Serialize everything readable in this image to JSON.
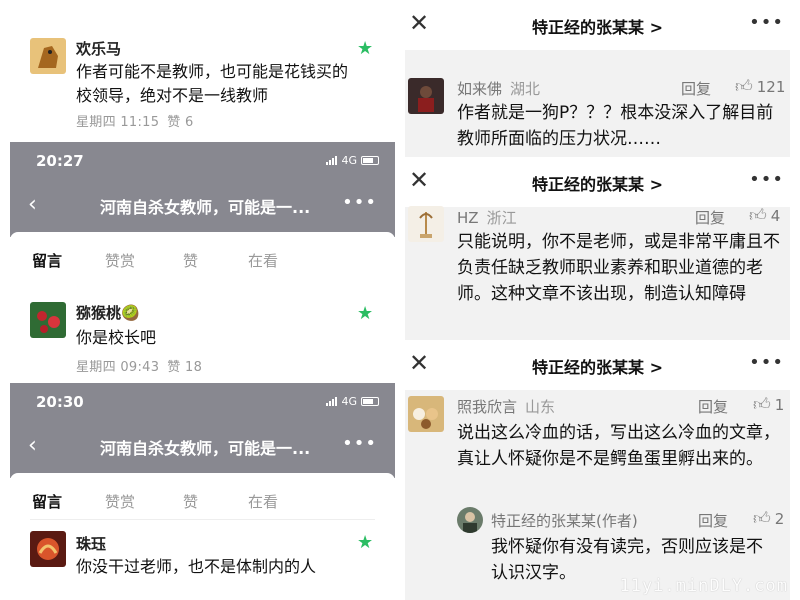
{
  "left": {
    "comment1": {
      "name": "欢乐马",
      "text": "作者可能不是教师，也可能是花钱买的校领导，绝对不是一线教师",
      "day": "星期四 11:15",
      "likes": "赞 6"
    },
    "screen2": {
      "time": "20:27",
      "network": "4G",
      "title": "河南自杀女教师，可能是一...",
      "tabs": [
        "留言",
        "赞赏",
        "赞",
        "在看"
      ],
      "comment": {
        "name": "猕猴桃🥝",
        "text": "你是校长吧",
        "day": "星期四 09:43",
        "likes": "赞 18"
      }
    },
    "screen3": {
      "time": "20:30",
      "network": "4G",
      "title": "河南自杀女教师，可能是一...",
      "tabs": [
        "留言",
        "赞赏",
        "赞",
        "在看"
      ],
      "comment": {
        "name": "珠珏",
        "text": "你没干过老师，也不是体制内的人"
      }
    }
  },
  "right": {
    "header_title": "特正经的张某某 >",
    "reply_label": "回复",
    "block1": {
      "name": "如来佛",
      "location": "湖北",
      "likes": "121",
      "text": "作者就是一狗P？？？根本没深入了解目前教师所面临的压力状况……"
    },
    "block2": {
      "name": "HZ",
      "location": "浙江",
      "likes": "4",
      "text": "只能说明，你不是老师，或是非常平庸且不负责任缺乏教师职业素养和职业道德的老师。这种文章不该出现，制造认知障碍"
    },
    "block3": {
      "name": "照我欣言",
      "location": "山东",
      "likes": "1",
      "text": "说出这么冷血的话，写出这么冷血的文章，真让人怀疑你是不是鳄鱼蛋里孵出来的。",
      "sub": {
        "name": "特正经的张某某(作者)",
        "likes": "2",
        "text": "我怀疑你有没有读完，否则应该是不认识汉字。"
      }
    },
    "watermark": "11yi.minDLY.com"
  },
  "colors": {
    "accent_green": "#2bbd63",
    "bar_gray": "#888890",
    "panel_gray": "#f2f2f2"
  },
  "icons": [
    "star-icon",
    "back-chevron-icon",
    "more-dots-icon",
    "close-icon",
    "thumb-up-icon",
    "signal-icon",
    "battery-icon"
  ]
}
